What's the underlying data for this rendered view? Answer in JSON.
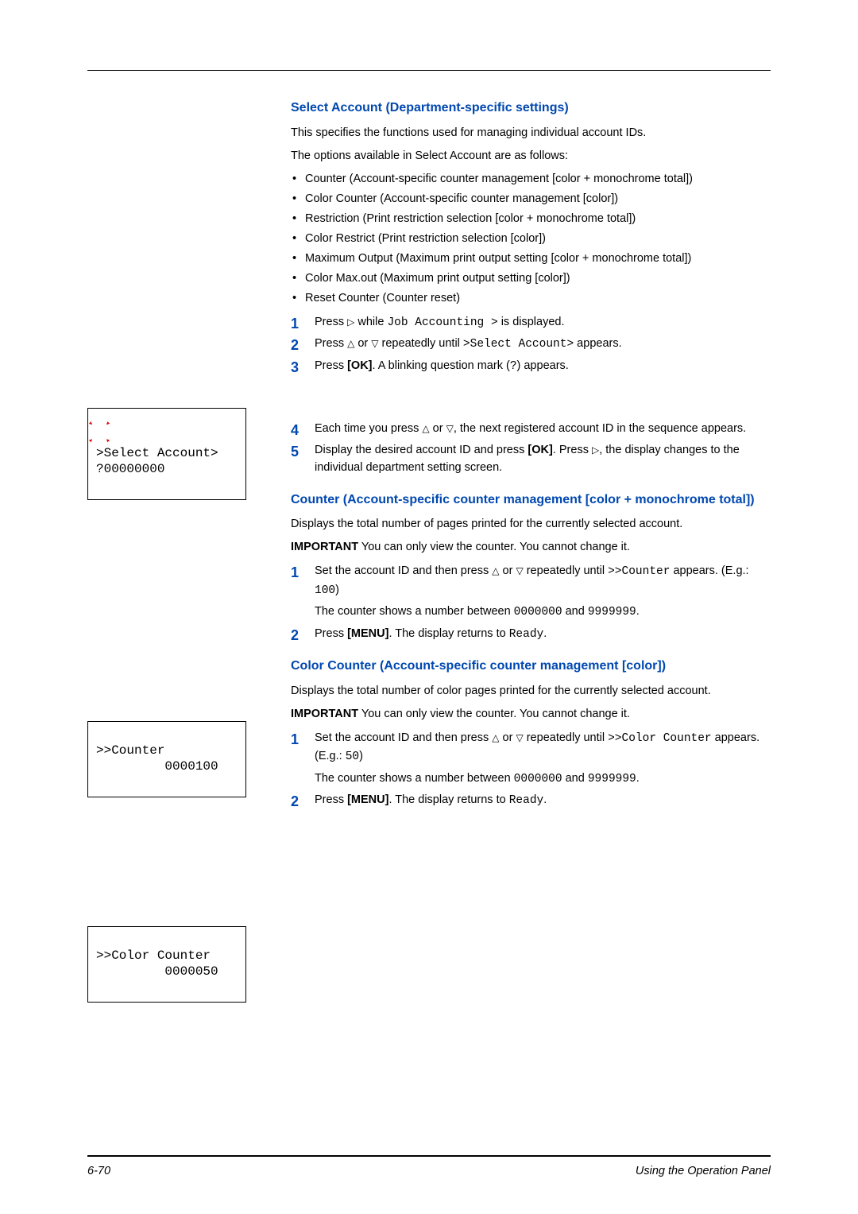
{
  "heading1": "Select Account (Department-specific settings)",
  "intro1": "This specifies the functions used for managing individual account IDs.",
  "intro2": "The options available in Select Account are as follows:",
  "bullets": [
    "Counter (Account-specific counter management [color + monochrome total])",
    "Color Counter (Account-specific counter management [color])",
    "Restriction (Print restriction selection [color + monochrome total])",
    "Color Restrict (Print restriction selection [color])",
    "Maximum Output (Maximum print output setting [color + monochrome total])",
    "Color Max.out (Maximum print output setting [color])",
    "Reset Counter (Counter reset)"
  ],
  "step1_pre": "Press ",
  "step1_mid": " while ",
  "step1_code": "Job Accounting >",
  "step1_post": " is displayed.",
  "step2_pre": "Press ",
  "step2_mid": " or ",
  "step2_mid2": " repeatedly until ",
  "step2_code": ">Select Account>",
  "step2_post": " appears.",
  "step3_pre": "Press ",
  "step3_bold": "[OK]",
  "step3_mid": ". A blinking question mark (",
  "step3_code": "?",
  "step3_post": ") appears.",
  "step4_pre": "Each time you press ",
  "step4_mid": " or ",
  "step4_post": ", the next registered account ID in the sequence appears.",
  "step5_pre": "Display the desired account ID and press ",
  "step5_bold": "[OK]",
  "step5_mid": ". Press ",
  "step5_post": ", the display changes to the individual department setting screen.",
  "heading2": "Counter (Account-specific counter management [color + monochrome total])",
  "counter_intro": "Displays the total number of pages printed for the currently selected account.",
  "important_label": "IMPORTANT",
  "important_counter": "  You can only view the counter. You cannot change it.",
  "cstep1_pre": "Set the account ID and then press ",
  "cstep1_mid": " or ",
  "cstep1_mid2": " repeatedly until ",
  "cstep1_code": ">>Counter",
  "cstep1_mid3": " appears. (E.g.: ",
  "cstep1_eg": "100",
  "cstep1_post": ")",
  "cstep1b_pre": "The counter shows a number between ",
  "cstep1b_n1": "0000000",
  "cstep1b_mid": " and ",
  "cstep1b_n2": "9999999",
  "cstep1b_post": ".",
  "cstep2_pre": "Press ",
  "cstep2_bold": "[MENU]",
  "cstep2_mid": ". The display returns to ",
  "cstep2_code": "Ready",
  "cstep2_post": ".",
  "heading3": "Color Counter (Account-specific counter management [color])",
  "color_intro": "Displays the total number of color pages printed for the currently selected account.",
  "ccstep1_pre": "Set the account ID and then press ",
  "ccstep1_mid": " or ",
  "ccstep1_mid2": " repeatedly until ",
  "ccstep1_code": ">>Color Counter",
  "ccstep1_mid3": " appears. (E.g.: ",
  "ccstep1_eg": "50",
  "ccstep1_post": ")",
  "ccstep2_pre": " Press ",
  "ccstep2_bold": "[MENU]",
  "ccstep2_mid": ". The display returns to ",
  "ccstep2_code": "Ready",
  "ccstep2_post": ".",
  "lcd1_line1": ">Select Account>",
  "lcd1_line2": "?00000000",
  "lcd2_line1": ">>Counter",
  "lcd2_line2": "         0000100",
  "lcd3_line1": ">>Color Counter",
  "lcd3_line2": "         0000050",
  "glyph_right": "▷",
  "glyph_up": "△",
  "glyph_down": "▽",
  "footer_page": "6-70",
  "footer_title": "Using the Operation Panel"
}
